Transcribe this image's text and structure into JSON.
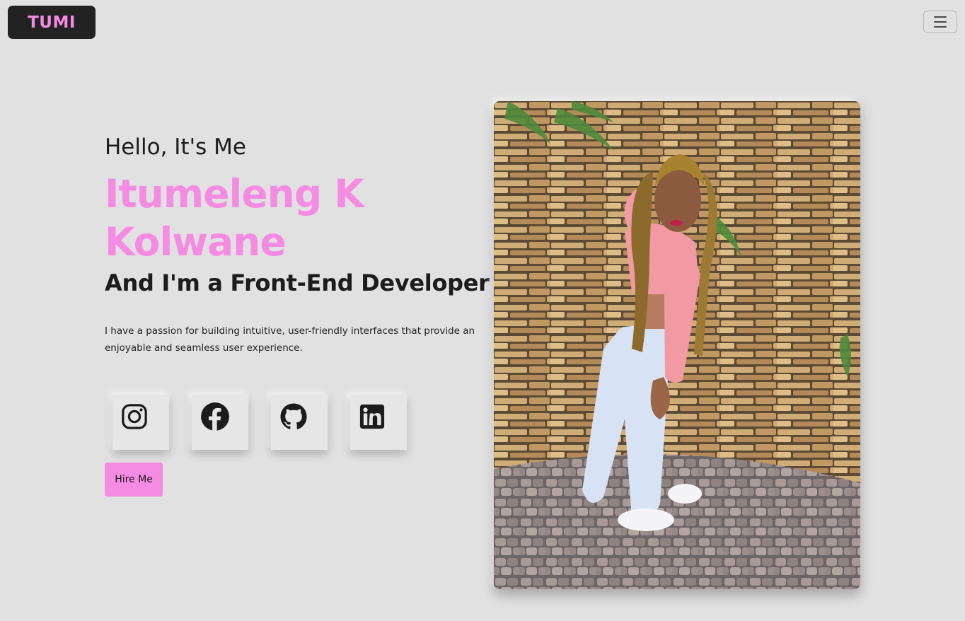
{
  "nav": {
    "brand": "TUMI",
    "menu_toggle_icon": "hamburger-menu-icon"
  },
  "hero": {
    "greeting": "Hello, It's Me",
    "name": "Itumeleng K Kolwane",
    "role": "And I'm a Front-End Developer",
    "description": "I have a passion for building intuitive, user-friendly interfaces that provide an enjoyable and seamless user experience.",
    "social_links": [
      {
        "icon": "instagram-icon"
      },
      {
        "icon": "facebook-icon"
      },
      {
        "icon": "github-icon"
      },
      {
        "icon": "linkedin-icon"
      }
    ],
    "cta_label": "Hire Me"
  },
  "photo": {
    "subject": "profile-photo"
  },
  "colors": {
    "background": "#e1e1e1",
    "accent": "#f58be3",
    "brand_bg": "#222222",
    "text": "#1c1c1c"
  }
}
